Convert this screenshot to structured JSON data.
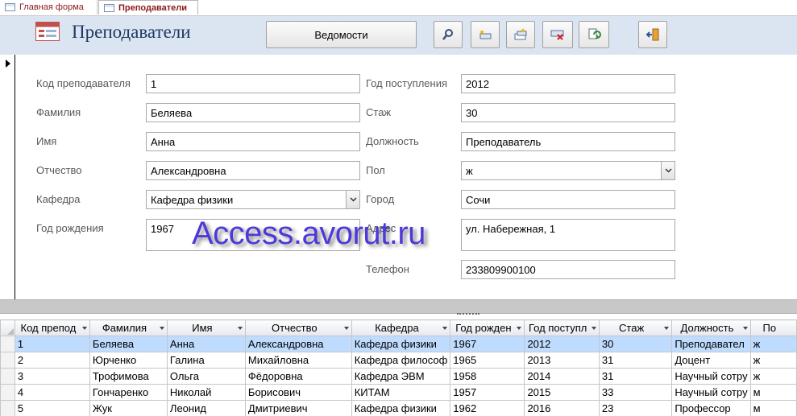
{
  "tabs": [
    {
      "label": "Главная форма",
      "icon": "form-icon"
    },
    {
      "label": "Преподаватели",
      "icon": "form-icon",
      "active": true
    }
  ],
  "header": {
    "title": "Преподаватели",
    "reports_button": "Ведомости",
    "icons": [
      "search-icon",
      "new-record-icon",
      "copy-record-icon",
      "delete-record-icon",
      "refresh-icon",
      "exit-icon"
    ]
  },
  "form": {
    "teacher_id": {
      "label": "Код преподавателя",
      "value": "1"
    },
    "last_name": {
      "label": "Фамилия",
      "value": "Беляева"
    },
    "first_name": {
      "label": "Имя",
      "value": "Анна"
    },
    "patronymic": {
      "label": "Отчество",
      "value": "Александровна"
    },
    "department": {
      "label": "Кафедра",
      "value": "Кафедра физики"
    },
    "birth_year": {
      "label": "Год рождения",
      "value": "1967"
    },
    "hire_year": {
      "label": "Год поступления",
      "value": "2012"
    },
    "experience": {
      "label": "Стаж",
      "value": "30"
    },
    "position": {
      "label": "Должность",
      "value": "Преподаватель"
    },
    "gender": {
      "label": "Пол",
      "value": "ж"
    },
    "city": {
      "label": "Город",
      "value": "Сочи"
    },
    "address": {
      "label": "Адрес",
      "value": "ул. Набережная, 1"
    },
    "phone": {
      "label": "Телефон",
      "value": "233809900100"
    }
  },
  "watermark": "Access.avorut.ru",
  "grid": {
    "columns": [
      "Код препод",
      "Фамилия",
      "Имя",
      "Отчество",
      "Кафедра",
      "Год рожден",
      "Год поступл",
      "Стаж",
      "Должность",
      "По"
    ],
    "rows": [
      [
        "1",
        "Беляева",
        "Анна",
        "Александровна",
        "Кафедра физики",
        "1967",
        "2012",
        "30",
        "Преподавател",
        "ж"
      ],
      [
        "2",
        "Юрченко",
        "Галина",
        "Михайловна",
        "Кафедра философ",
        "1965",
        "2013",
        "31",
        "Доцент",
        "ж"
      ],
      [
        "3",
        "Трофимова",
        "Ольга",
        "Фёдоровна",
        "Кафедра ЭВМ",
        "1958",
        "2014",
        "31",
        "Научный сотру",
        "ж"
      ],
      [
        "4",
        "Гончаренко",
        "Николай",
        "Борисович",
        "КИТАМ",
        "1957",
        "2015",
        "33",
        "Научный сотру",
        "м"
      ],
      [
        "5",
        "Жук",
        "Леонид",
        "Дмитриевич",
        "Кафедра физики",
        "1962",
        "2016",
        "23",
        "Профессор",
        "м"
      ]
    ]
  },
  "colors": {
    "header_bg": "#dbe5f1",
    "title": "#1f3864",
    "tab_text": "#8b1a1a",
    "selected_row": "#bfdcff",
    "watermark": "#4b3ad8"
  }
}
